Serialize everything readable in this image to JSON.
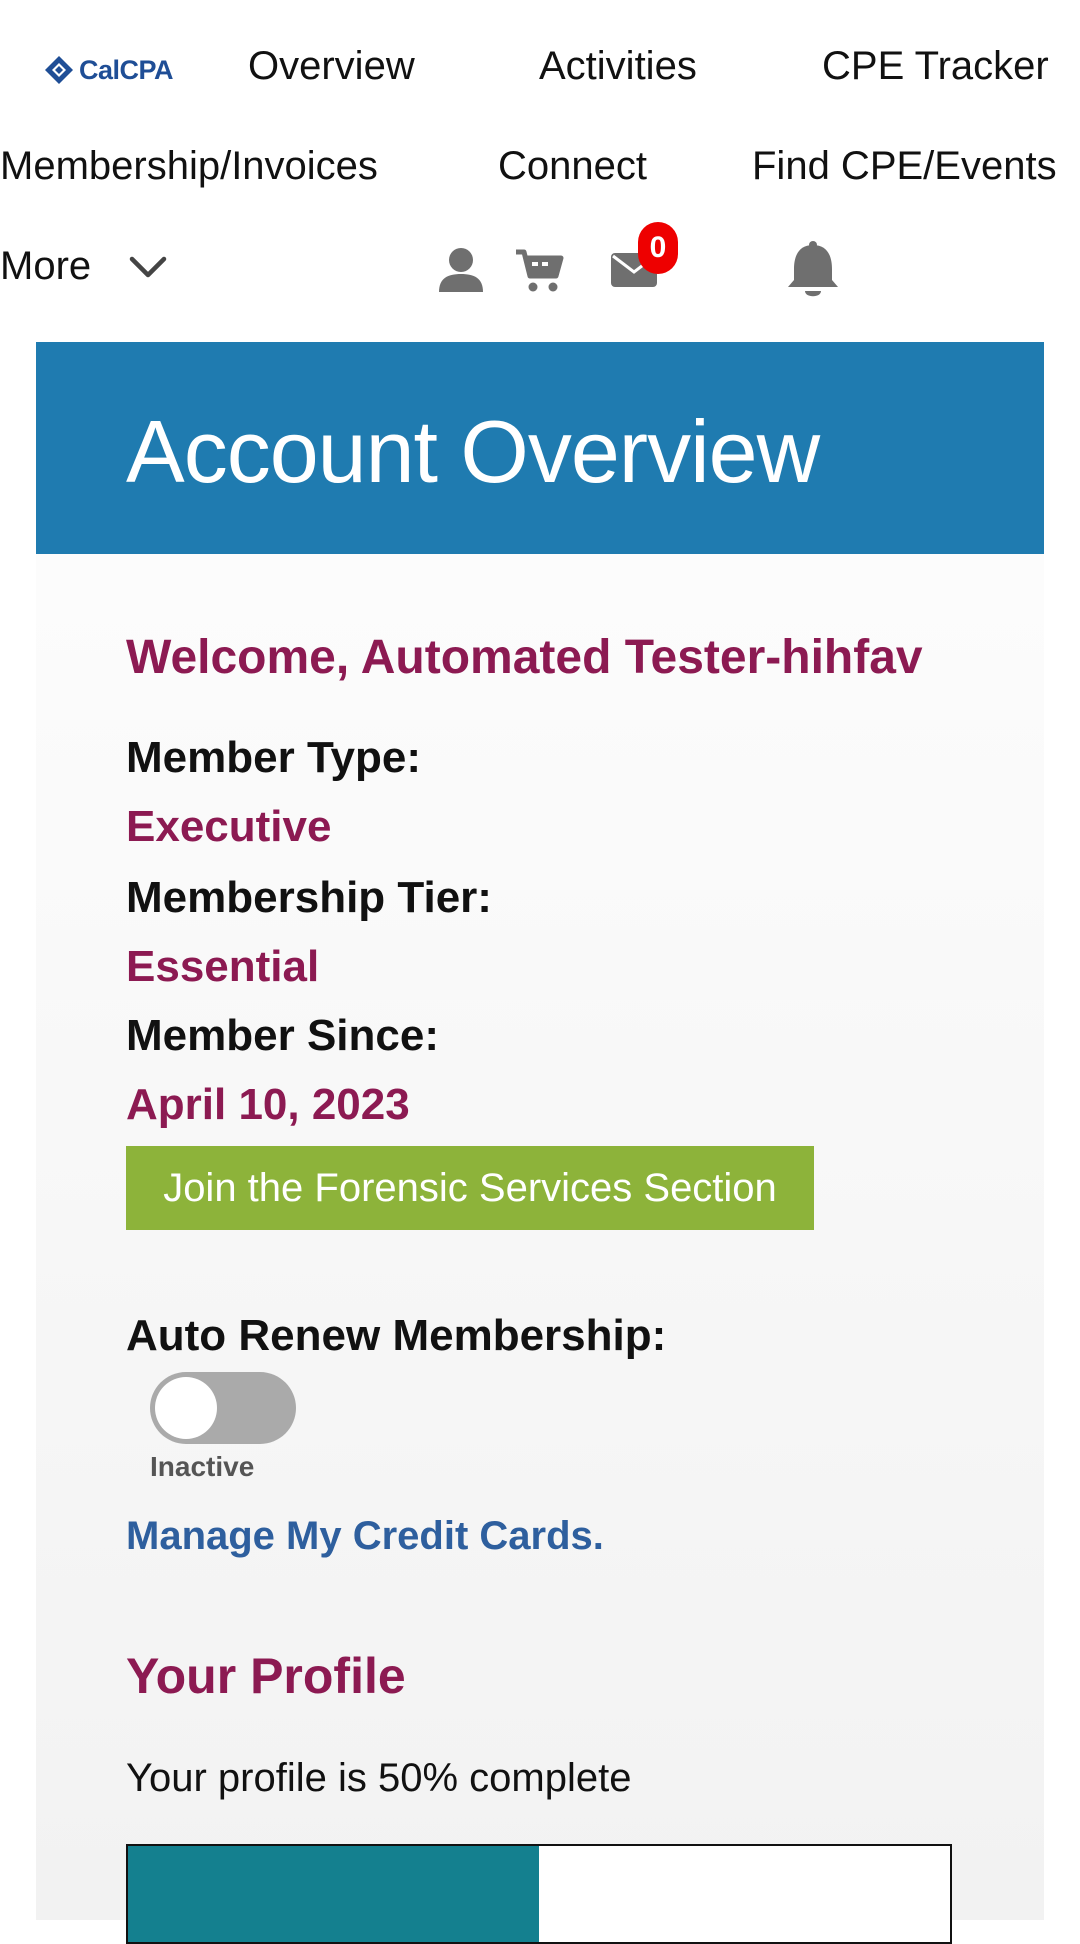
{
  "nav": {
    "logo_text": "CalCPA",
    "links": [
      "Overview",
      "Activities",
      "CPE Tracker",
      "Membership/Invoices",
      "Connect",
      "Find CPE/Events",
      "More"
    ],
    "messages_count": "0",
    "icons": [
      "user-icon",
      "cart-icon",
      "envelope-icon",
      "bell-icon",
      "chevron-down-icon"
    ]
  },
  "header": {
    "title": "Account Overview",
    "background_color": "#1f7bb0"
  },
  "account": {
    "welcome": "Welcome, Automated Tester-hihfav",
    "member_type_label": "Member Type:",
    "member_type_value": "Executive",
    "tier_label": "Membership Tier:",
    "tier_value": "Essential",
    "since_label": "Member Since:",
    "since_value": "April 10, 2023",
    "join_button": "Join the Forensic Services Section",
    "auto_renew_label": "Auto Renew Membership:",
    "auto_renew_on": false,
    "auto_renew_status": "Inactive",
    "manage_cards_link": "Manage My Credit Cards."
  },
  "profile": {
    "title": "Your Profile",
    "completion_text": "Your profile is 50% complete",
    "completion_percent": 50
  },
  "colors": {
    "accent_maroon": "#8c1a52",
    "button_green": "#8db33a",
    "link_blue": "#2e5f9e",
    "progress_teal": "#14808f",
    "badge_red": "#ee0000"
  }
}
